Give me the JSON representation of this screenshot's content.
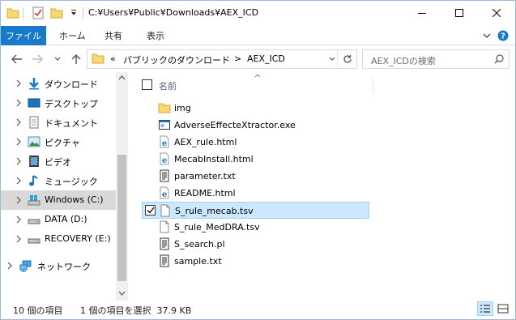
{
  "window": {
    "title": "C:¥Users¥Public¥Downloads¥AEX_ICD"
  },
  "ribbon": {
    "tabs": [
      "ファイル",
      "ホーム",
      "共有",
      "表示"
    ]
  },
  "address": {
    "overflow": "«",
    "segments": [
      "パブリックのダウンロード",
      "AEX_ICD"
    ],
    "separator": ">"
  },
  "search": {
    "placeholder": "AEX_ICDの検索"
  },
  "nav": {
    "items": [
      {
        "label": "ダウンロード",
        "icon": "download-arrow-icon",
        "selected": false
      },
      {
        "label": "デスクトップ",
        "icon": "desktop-icon",
        "selected": false
      },
      {
        "label": "ドキュメント",
        "icon": "document-icon",
        "selected": false
      },
      {
        "label": "ピクチャ",
        "icon": "pictures-icon",
        "selected": false
      },
      {
        "label": "ビデオ",
        "icon": "video-icon",
        "selected": false
      },
      {
        "label": "ミュージック",
        "icon": "music-icon",
        "selected": false
      },
      {
        "label": "Windows (C:)",
        "icon": "windows-drive-icon",
        "selected": true
      },
      {
        "label": "DATA (D:)",
        "icon": "drive-icon",
        "selected": false
      },
      {
        "label": "RECOVERY (E:)",
        "icon": "drive-icon",
        "selected": false
      },
      {
        "label": "ネットワーク",
        "icon": "network-icon",
        "selected": false
      }
    ]
  },
  "list": {
    "column_name": "名前",
    "files": [
      {
        "name": "img",
        "icon": "folder-icon",
        "selected": false
      },
      {
        "name": "AdverseEffecteXtractor.exe",
        "icon": "exe-icon",
        "selected": false
      },
      {
        "name": "AEX_rule.html",
        "icon": "ie-html-icon",
        "selected": false
      },
      {
        "name": "MecabInstall.html",
        "icon": "ie-html-icon",
        "selected": false
      },
      {
        "name": "parameter.txt",
        "icon": "text-file-icon",
        "selected": false
      },
      {
        "name": "README.html",
        "icon": "ie-html-icon",
        "selected": false
      },
      {
        "name": "S_rule_mecab.tsv",
        "icon": "blank-file-icon",
        "selected": true
      },
      {
        "name": "S_rule_MedDRA.tsv",
        "icon": "blank-file-icon",
        "selected": false
      },
      {
        "name": "S_search.pl",
        "icon": "text-file-icon",
        "selected": false
      },
      {
        "name": "sample.txt",
        "icon": "text-file-icon",
        "selected": false
      }
    ]
  },
  "status": {
    "item_count": "10 個の項目",
    "selection": "1 個の項目を選択  37.9 KB"
  },
  "colors": {
    "accent": "#1979ca",
    "selection_bg": "#cce8ff",
    "selection_border": "#99d1ff",
    "nav_selected_bg": "#d9d9d9",
    "folder_yellow": "#f8d775"
  }
}
